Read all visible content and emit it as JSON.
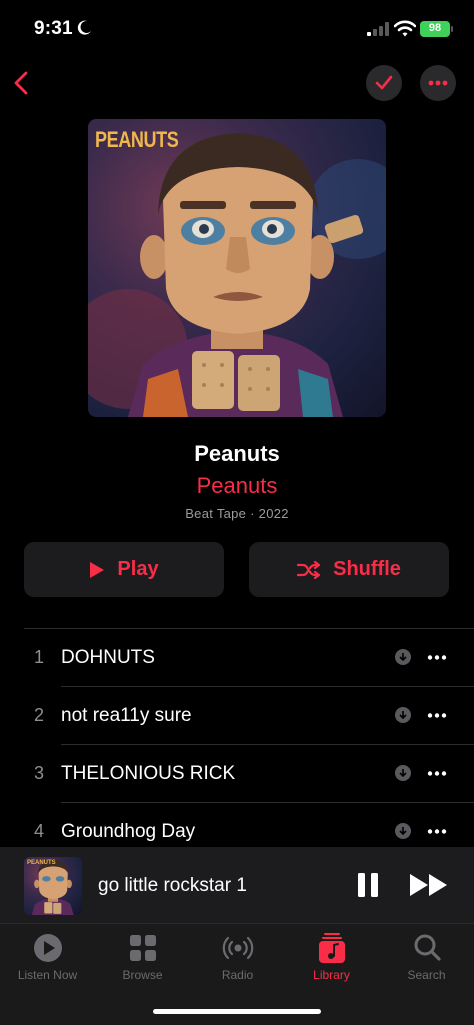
{
  "status_bar": {
    "time": "9:31",
    "battery": "98"
  },
  "header": {
    "back_icon": "chevron-left-icon",
    "check_icon": "checkmark-icon",
    "more_icon": "ellipsis-icon"
  },
  "album": {
    "art_text": "PEANUTS",
    "title": "Peanuts",
    "artist": "Peanuts",
    "meta": "Beat Tape · 2022"
  },
  "actions": {
    "play_label": "Play",
    "shuffle_label": "Shuffle"
  },
  "tracks": [
    {
      "number": "1",
      "title": "DOHNUTS"
    },
    {
      "number": "2",
      "title": "not rea11y sure"
    },
    {
      "number": "3",
      "title": "THELONIOUS RICK"
    },
    {
      "number": "4",
      "title": "Groundhog Day"
    }
  ],
  "mini_player": {
    "art_text": "PEANUTS",
    "title": "go little rockstar 1"
  },
  "tabs": [
    {
      "label": "Listen Now",
      "icon": "play-circle-icon",
      "active": false
    },
    {
      "label": "Browse",
      "icon": "grid-icon",
      "active": false
    },
    {
      "label": "Radio",
      "icon": "radio-icon",
      "active": false
    },
    {
      "label": "Library",
      "icon": "music-note-icon",
      "active": true
    },
    {
      "label": "Search",
      "icon": "search-icon",
      "active": false
    }
  ],
  "colors": {
    "accent": "#fa2d48",
    "background": "#000000",
    "button_bg": "#1c1c1e"
  }
}
